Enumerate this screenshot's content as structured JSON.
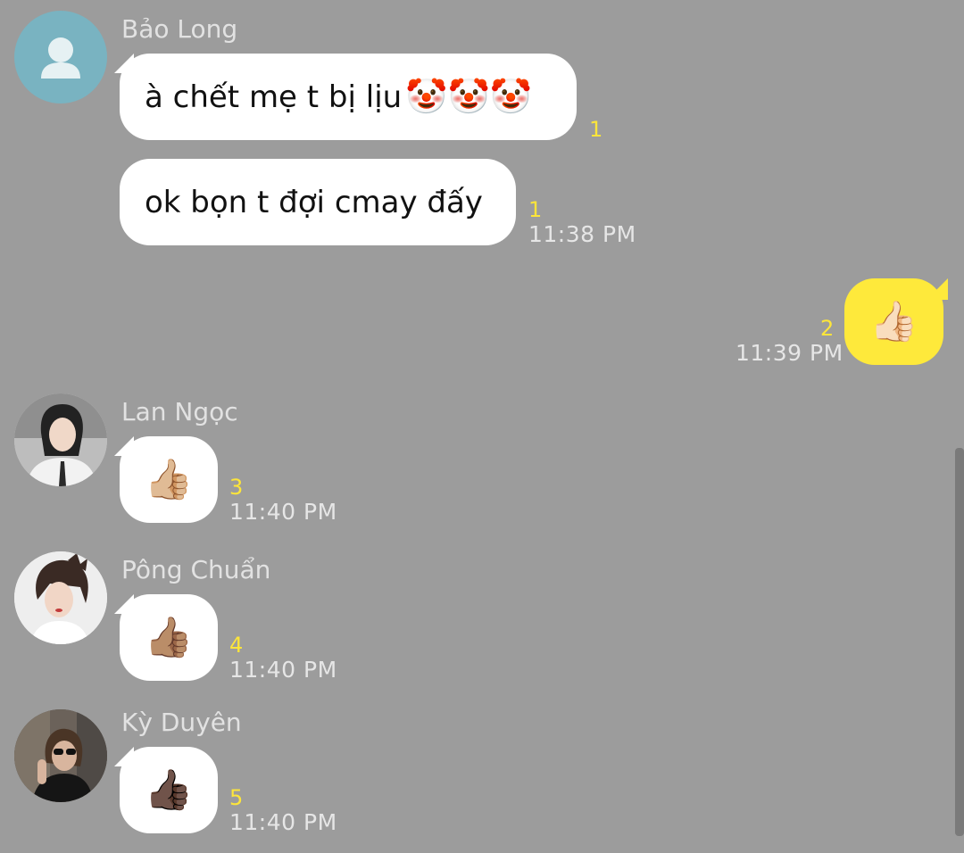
{
  "colors": {
    "background": "#9c9c9c",
    "incoming_bubble": "#ffffff",
    "outgoing_bubble": "#fee93b",
    "unread_count": "#fde53a",
    "meta_text": "#e6e6e6"
  },
  "messages": [
    {
      "sender": "Bảo Long",
      "avatar_icon": "default-profile-icon",
      "bubbles": [
        {
          "text": "à chết mẹ t bị lịu",
          "emoji": "🤡🤡🤡",
          "unread": "1"
        },
        {
          "text": "ok bọn t đợi cmay đấy",
          "unread": "1",
          "time": "11:38 PM"
        }
      ]
    },
    {
      "sender": "me",
      "bubbles": [
        {
          "emoji": "👍🏻",
          "unread": "2",
          "time": "11:39 PM"
        }
      ]
    },
    {
      "sender": "Lan Ngọc",
      "avatar_icon": "photo-avatar",
      "bubbles": [
        {
          "emoji": "👍🏼",
          "unread": "3",
          "time": "11:40 PM"
        }
      ]
    },
    {
      "sender": "Pông Chuẩn",
      "avatar_icon": "photo-avatar",
      "bubbles": [
        {
          "emoji": "👍🏽",
          "unread": "4",
          "time": "11:40 PM"
        }
      ]
    },
    {
      "sender": "Kỳ Duyên",
      "avatar_icon": "photo-avatar",
      "bubbles": [
        {
          "emoji": "👍🏿",
          "unread": "5",
          "time": "11:40 PM"
        }
      ]
    }
  ]
}
